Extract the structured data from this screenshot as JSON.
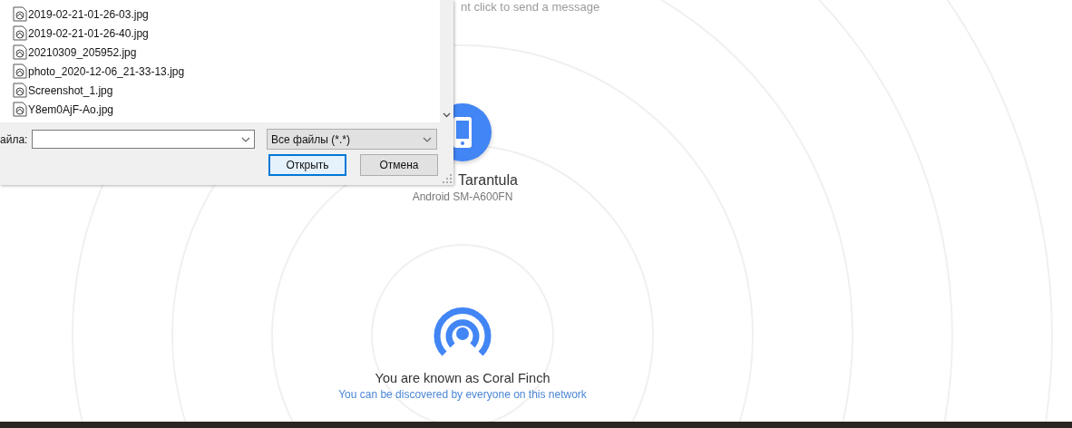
{
  "background_app": {
    "hint": "nt click to send a message",
    "peer": {
      "name": "Tarantula",
      "device": "Android SM-A600FN"
    },
    "self": {
      "name_line": "You are known as Coral Finch",
      "discovery_note": "You can be discovered by everyone on this network"
    }
  },
  "file_dialog": {
    "files": [
      {
        "name": "2019-02-21-01-26-03.jpg"
      },
      {
        "name": "2019-02-21-01-26-40.jpg"
      },
      {
        "name": "20210309_205952.jpg"
      },
      {
        "name": "photo_2020-12-06_21-33-13.jpg"
      },
      {
        "name": "Screenshot_1.jpg"
      },
      {
        "name": "Y8em0AjF-Ao.jpg"
      }
    ],
    "file_name_label": "айла:",
    "file_type": "Все файлы (*.*)",
    "buttons": [
      {
        "label": "Открыть",
        "kind": "primary"
      },
      {
        "label": "Отмена",
        "kind": "secondary"
      }
    ]
  }
}
